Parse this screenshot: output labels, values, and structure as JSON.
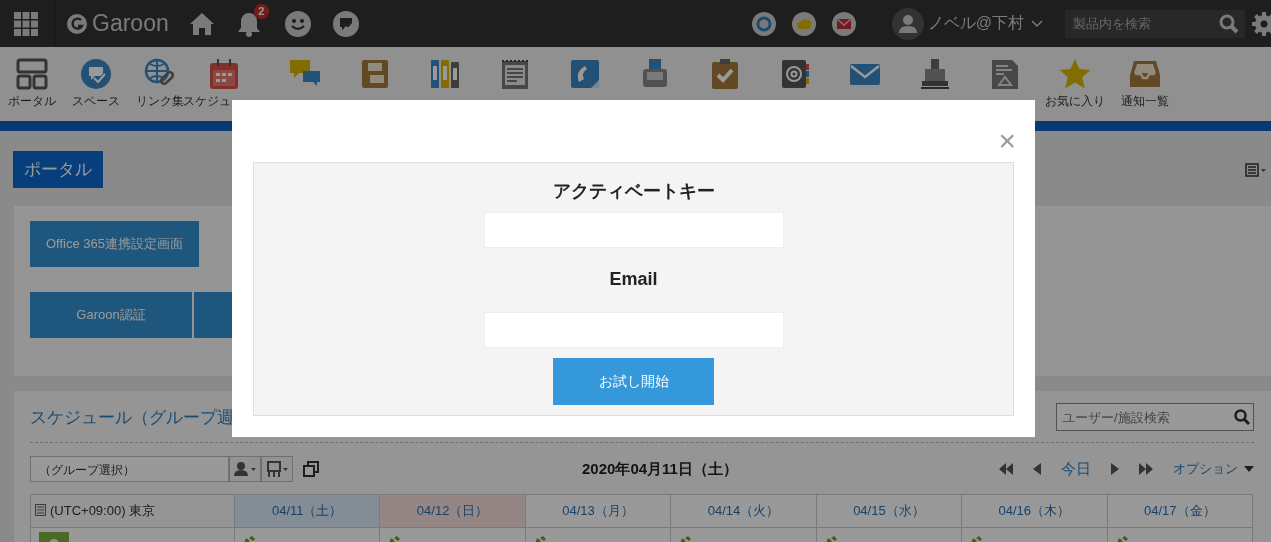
{
  "header": {
    "logo": "Garoon",
    "notification_count": "2",
    "user": "ノベル@下村",
    "search": {
      "placeholder": "製品内を検索"
    }
  },
  "app_toolbar": {
    "items": [
      {
        "kind": "layout",
        "label": "ポータル"
      },
      {
        "kind": "bubble",
        "label": "スペース"
      },
      {
        "kind": "globe",
        "label": "リンク集"
      },
      {
        "kind": "calendar",
        "label": "スケジュ"
      },
      {
        "kind": "chat"
      },
      {
        "kind": "board"
      },
      {
        "kind": "binders"
      },
      {
        "kind": "memo"
      },
      {
        "kind": "phone"
      },
      {
        "kind": "device"
      },
      {
        "kind": "todo"
      },
      {
        "kind": "address"
      },
      {
        "kind": "mail"
      },
      {
        "kind": "stamp"
      },
      {
        "kind": "report"
      },
      {
        "kind": "star",
        "label": "お気に入り"
      },
      {
        "kind": "tray",
        "label": "通知一覧"
      }
    ]
  },
  "page_title": "ポータル",
  "portlet_buttons": [
    [
      {
        "kind": "text",
        "label": "Office 365連携設定画面"
      }
    ],
    [
      {
        "kind": "text",
        "label": "Garoon認証"
      },
      {
        "kind": "covered"
      }
    ]
  ],
  "schedule": {
    "title": "スケジュール（グループ週",
    "search": {
      "placeholder": "ユーザー/施設検索"
    },
    "group_select": "（グループ選択）",
    "date": "2020年04月11日（土）",
    "today": "今日",
    "options": "オプション",
    "timezone": "(UTC+09:00) 東京",
    "days": [
      {
        "label": "04/11（土）",
        "kind": "saturday"
      },
      {
        "label": "04/12（日）",
        "kind": "sunday"
      },
      {
        "label": "04/13（月）",
        "kind": "weekday"
      },
      {
        "label": "04/14（火）",
        "kind": "weekday"
      },
      {
        "label": "04/15（水）",
        "kind": "weekday"
      },
      {
        "label": "04/16（木）",
        "kind": "weekday"
      },
      {
        "label": "04/17（金）",
        "kind": "weekday"
      }
    ]
  },
  "modal": {
    "close": "×",
    "fields": [
      {
        "label": "アクティベートキー"
      },
      {
        "label": "Email"
      }
    ],
    "button": "お試し開始"
  }
}
